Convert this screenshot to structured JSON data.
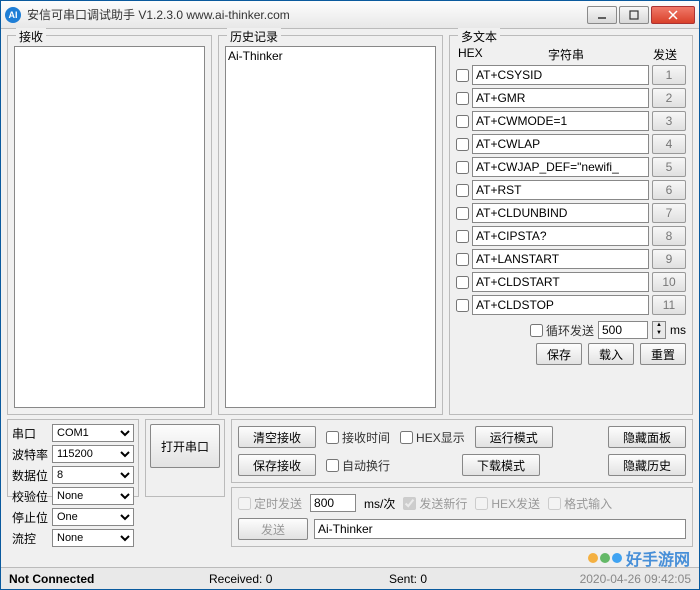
{
  "window": {
    "title": "安信可串口调试助手  V1.2.3.0       www.ai-thinker.com"
  },
  "groups": {
    "recv": "接收",
    "hist": "历史记录",
    "multi": "多文本"
  },
  "history_content": "Ai-Thinker",
  "multi": {
    "head_hex": "HEX",
    "head_str": "字符串",
    "head_send": "发送",
    "rows": [
      {
        "txt": "AT+CSYSID",
        "btn": "1"
      },
      {
        "txt": "AT+GMR",
        "btn": "2"
      },
      {
        "txt": "AT+CWMODE=1",
        "btn": "3"
      },
      {
        "txt": "AT+CWLAP",
        "btn": "4"
      },
      {
        "txt": "AT+CWJAP_DEF=\"newifi_",
        "btn": "5"
      },
      {
        "txt": "AT+RST",
        "btn": "6"
      },
      {
        "txt": "AT+CLDUNBIND",
        "btn": "7"
      },
      {
        "txt": "AT+CIPSTA?",
        "btn": "8"
      },
      {
        "txt": "AT+LANSTART",
        "btn": "9"
      },
      {
        "txt": "AT+CLDSTART",
        "btn": "10"
      },
      {
        "txt": "AT+CLDSTOP",
        "btn": "11"
      }
    ],
    "loop_label": "循环发送",
    "loop_val": "500",
    "loop_unit": "ms",
    "save": "保存",
    "load": "载入",
    "reset": "重置"
  },
  "serial": {
    "port_l": "串口",
    "port_v": "COM1",
    "baud_l": "波特率",
    "baud_v": "115200",
    "data_l": "数据位",
    "data_v": "8",
    "parity_l": "校验位",
    "parity_v": "None",
    "stop_l": "停止位",
    "stop_v": "One",
    "flow_l": "流控",
    "flow_v": "None",
    "open": "打开串口"
  },
  "opts": {
    "clear_recv": "清空接收",
    "save_recv": "保存接收",
    "recv_time": "接收时间",
    "hex_disp": "HEX显示",
    "auto_wrap": "自动换行",
    "run_mode": "运行模式",
    "dl_mode": "下载模式",
    "hide_panel": "隐藏面板",
    "hide_hist": "隐藏历史"
  },
  "send": {
    "timed": "定时发送",
    "interval": "800",
    "unit": "ms/次",
    "newline": "发送新行",
    "hex_send": "HEX发送",
    "fmt_input": "格式输入",
    "send_btn": "发送",
    "content": "Ai-Thinker"
  },
  "status": {
    "conn": "Not Connected",
    "recv": "Received: 0",
    "sent": "Sent: 0",
    "time": "2020-04-26 09:42:05"
  },
  "watermark": "好手游网"
}
